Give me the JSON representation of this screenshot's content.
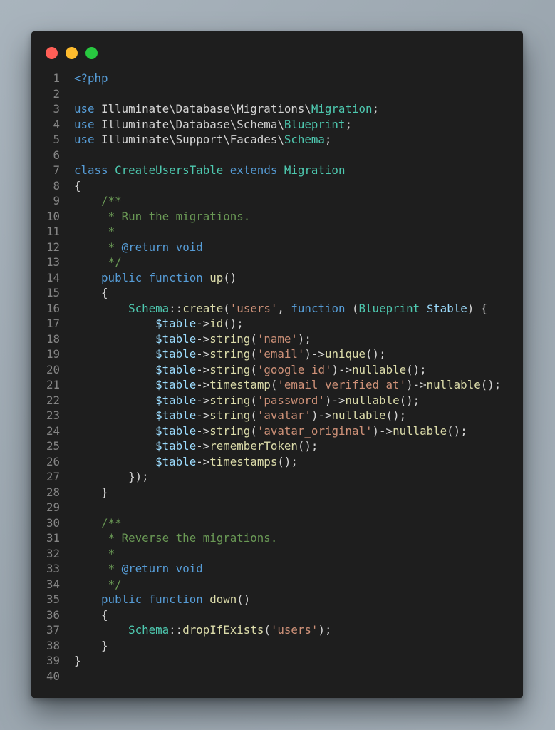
{
  "window": {
    "controls": [
      {
        "name": "close",
        "color": "#ff5f57"
      },
      {
        "name": "minimize",
        "color": "#febc2e"
      },
      {
        "name": "maximize",
        "color": "#28c840"
      }
    ]
  },
  "theme": {
    "keyword": "#569cd6",
    "class": "#4ec9b0",
    "string": "#ce9178",
    "function": "#dcdcaa",
    "variable": "#9cdcfe",
    "comment": "#6a9955",
    "plain": "#d4d4d4",
    "line_number": "#858585",
    "background": "#1e1e1e"
  },
  "language": "php",
  "lines": [
    [
      [
        "kw",
        "<?php"
      ]
    ],
    [],
    [
      [
        "kw",
        "use"
      ],
      [
        "pl",
        " Illuminate\\Database\\Migrations\\"
      ],
      [
        "cls",
        "Migration"
      ],
      [
        "pl",
        ";"
      ]
    ],
    [
      [
        "kw",
        "use"
      ],
      [
        "pl",
        " Illuminate\\Database\\Schema\\"
      ],
      [
        "cls",
        "Blueprint"
      ],
      [
        "pl",
        ";"
      ]
    ],
    [
      [
        "kw",
        "use"
      ],
      [
        "pl",
        " Illuminate\\Support\\Facades\\"
      ],
      [
        "cls",
        "Schema"
      ],
      [
        "pl",
        ";"
      ]
    ],
    [],
    [
      [
        "kw",
        "class"
      ],
      [
        "pl",
        " "
      ],
      [
        "cls",
        "CreateUsersTable"
      ],
      [
        "pl",
        " "
      ],
      [
        "kw",
        "extends"
      ],
      [
        "pl",
        " "
      ],
      [
        "cls",
        "Migration"
      ]
    ],
    [
      [
        "pl",
        "{"
      ]
    ],
    [
      [
        "pl",
        "    "
      ],
      [
        "cm",
        "/**"
      ]
    ],
    [
      [
        "pl",
        "     "
      ],
      [
        "cm",
        "* Run the migrations."
      ]
    ],
    [
      [
        "pl",
        "     "
      ],
      [
        "cm",
        "*"
      ]
    ],
    [
      [
        "pl",
        "     "
      ],
      [
        "cm",
        "* "
      ],
      [
        "doc",
        "@return void"
      ]
    ],
    [
      [
        "pl",
        "     "
      ],
      [
        "cm",
        "*/"
      ]
    ],
    [
      [
        "pl",
        "    "
      ],
      [
        "kw",
        "public"
      ],
      [
        "pl",
        " "
      ],
      [
        "kw",
        "function"
      ],
      [
        "pl",
        " "
      ],
      [
        "fn",
        "up"
      ],
      [
        "pl",
        "()"
      ]
    ],
    [
      [
        "pl",
        "    {"
      ]
    ],
    [
      [
        "pl",
        "        "
      ],
      [
        "cls",
        "Schema"
      ],
      [
        "pl",
        "::"
      ],
      [
        "fn",
        "create"
      ],
      [
        "pl",
        "("
      ],
      [
        "str",
        "'users'"
      ],
      [
        "pl",
        ", "
      ],
      [
        "kw",
        "function"
      ],
      [
        "pl",
        " ("
      ],
      [
        "cls",
        "Blueprint"
      ],
      [
        "pl",
        " "
      ],
      [
        "var",
        "$table"
      ],
      [
        "pl",
        ") {"
      ]
    ],
    [
      [
        "pl",
        "            "
      ],
      [
        "var",
        "$table"
      ],
      [
        "pl",
        "->"
      ],
      [
        "fn",
        "id"
      ],
      [
        "pl",
        "();"
      ]
    ],
    [
      [
        "pl",
        "            "
      ],
      [
        "var",
        "$table"
      ],
      [
        "pl",
        "->"
      ],
      [
        "fn",
        "string"
      ],
      [
        "pl",
        "("
      ],
      [
        "str",
        "'name'"
      ],
      [
        "pl",
        ");"
      ]
    ],
    [
      [
        "pl",
        "            "
      ],
      [
        "var",
        "$table"
      ],
      [
        "pl",
        "->"
      ],
      [
        "fn",
        "string"
      ],
      [
        "pl",
        "("
      ],
      [
        "str",
        "'email'"
      ],
      [
        "pl",
        ")->"
      ],
      [
        "fn",
        "unique"
      ],
      [
        "pl",
        "();"
      ]
    ],
    [
      [
        "pl",
        "            "
      ],
      [
        "var",
        "$table"
      ],
      [
        "pl",
        "->"
      ],
      [
        "fn",
        "string"
      ],
      [
        "pl",
        "("
      ],
      [
        "str",
        "'google_id'"
      ],
      [
        "pl",
        ")->"
      ],
      [
        "fn",
        "nullable"
      ],
      [
        "pl",
        "();"
      ]
    ],
    [
      [
        "pl",
        "            "
      ],
      [
        "var",
        "$table"
      ],
      [
        "pl",
        "->"
      ],
      [
        "fn",
        "timestamp"
      ],
      [
        "pl",
        "("
      ],
      [
        "str",
        "'email_verified_at'"
      ],
      [
        "pl",
        ")->"
      ],
      [
        "fn",
        "nullable"
      ],
      [
        "pl",
        "();"
      ]
    ],
    [
      [
        "pl",
        "            "
      ],
      [
        "var",
        "$table"
      ],
      [
        "pl",
        "->"
      ],
      [
        "fn",
        "string"
      ],
      [
        "pl",
        "("
      ],
      [
        "str",
        "'password'"
      ],
      [
        "pl",
        ")->"
      ],
      [
        "fn",
        "nullable"
      ],
      [
        "pl",
        "();"
      ]
    ],
    [
      [
        "pl",
        "            "
      ],
      [
        "var",
        "$table"
      ],
      [
        "pl",
        "->"
      ],
      [
        "fn",
        "string"
      ],
      [
        "pl",
        "("
      ],
      [
        "str",
        "'avatar'"
      ],
      [
        "pl",
        ")->"
      ],
      [
        "fn",
        "nullable"
      ],
      [
        "pl",
        "();"
      ]
    ],
    [
      [
        "pl",
        "            "
      ],
      [
        "var",
        "$table"
      ],
      [
        "pl",
        "->"
      ],
      [
        "fn",
        "string"
      ],
      [
        "pl",
        "("
      ],
      [
        "str",
        "'avatar_original'"
      ],
      [
        "pl",
        ")->"
      ],
      [
        "fn",
        "nullable"
      ],
      [
        "pl",
        "();"
      ]
    ],
    [
      [
        "pl",
        "            "
      ],
      [
        "var",
        "$table"
      ],
      [
        "pl",
        "->"
      ],
      [
        "fn",
        "rememberToken"
      ],
      [
        "pl",
        "();"
      ]
    ],
    [
      [
        "pl",
        "            "
      ],
      [
        "var",
        "$table"
      ],
      [
        "pl",
        "->"
      ],
      [
        "fn",
        "timestamps"
      ],
      [
        "pl",
        "();"
      ]
    ],
    [
      [
        "pl",
        "        });"
      ]
    ],
    [
      [
        "pl",
        "    }"
      ]
    ],
    [],
    [
      [
        "pl",
        "    "
      ],
      [
        "cm",
        "/**"
      ]
    ],
    [
      [
        "pl",
        "     "
      ],
      [
        "cm",
        "* Reverse the migrations."
      ]
    ],
    [
      [
        "pl",
        "     "
      ],
      [
        "cm",
        "*"
      ]
    ],
    [
      [
        "pl",
        "     "
      ],
      [
        "cm",
        "* "
      ],
      [
        "doc",
        "@return void"
      ]
    ],
    [
      [
        "pl",
        "     "
      ],
      [
        "cm",
        "*/"
      ]
    ],
    [
      [
        "pl",
        "    "
      ],
      [
        "kw",
        "public"
      ],
      [
        "pl",
        " "
      ],
      [
        "kw",
        "function"
      ],
      [
        "pl",
        " "
      ],
      [
        "fn",
        "down"
      ],
      [
        "pl",
        "()"
      ]
    ],
    [
      [
        "pl",
        "    {"
      ]
    ],
    [
      [
        "pl",
        "        "
      ],
      [
        "cls",
        "Schema"
      ],
      [
        "pl",
        "::"
      ],
      [
        "fn",
        "dropIfExists"
      ],
      [
        "pl",
        "("
      ],
      [
        "str",
        "'users'"
      ],
      [
        "pl",
        ");"
      ]
    ],
    [
      [
        "pl",
        "    }"
      ]
    ],
    [
      [
        "pl",
        "}"
      ]
    ],
    []
  ]
}
